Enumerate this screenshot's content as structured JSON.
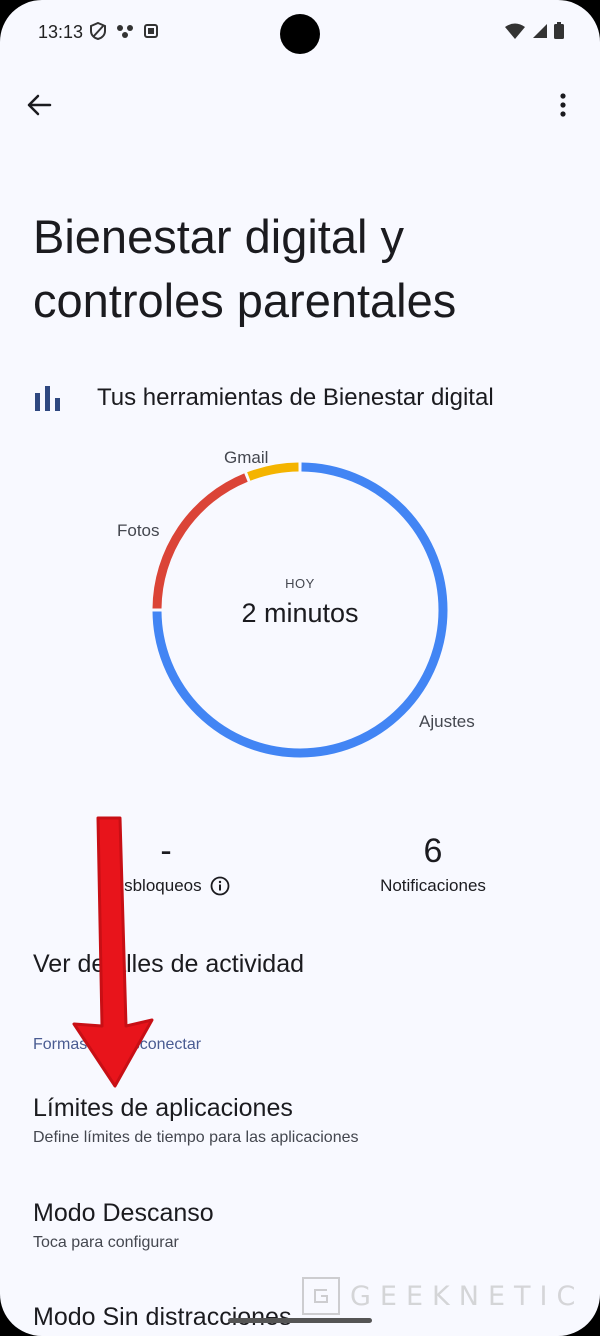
{
  "status": {
    "time": "13:13",
    "left_icons": [
      "shield-icon",
      "network-icon",
      "notification-app-icon"
    ],
    "right_icons": [
      "wifi-icon",
      "signal-icon",
      "battery-icon"
    ]
  },
  "header": {
    "back_icon": "arrow-left-icon",
    "more_icon": "more-vert-icon"
  },
  "page": {
    "title": "Bienestar digital y controles parentales"
  },
  "tools": {
    "label": "Tus herramientas de Bienestar digital",
    "icon": "bar-chart-icon"
  },
  "chart_data": {
    "type": "pie",
    "title": "",
    "center_label": "HOY",
    "center_value": "2 minutos",
    "series": [
      {
        "name": "Ajustes",
        "value": 75,
        "color": "#4285f4"
      },
      {
        "name": "Fotos",
        "value": 19,
        "color": "#db4437"
      },
      {
        "name": "Gmail",
        "value": 6,
        "color": "#f4b400"
      }
    ],
    "legend": "on-chart labels"
  },
  "stats": {
    "unlocks": {
      "value": "-",
      "label": "Desbloqueos",
      "icon": "info-icon"
    },
    "notifications": {
      "value": "6",
      "label": "Notificaciones"
    }
  },
  "activity_link": "Ver detalles de actividad",
  "section": {
    "label": "Formas de desconectar"
  },
  "items": [
    {
      "title": "Límites de aplicaciones",
      "subtitle": "Define límites de tiempo para las aplicaciones"
    },
    {
      "title": "Modo Descanso",
      "subtitle": "Toca para configurar"
    },
    {
      "title": "Modo Sin distracciones",
      "subtitle": ""
    }
  ],
  "watermark": {
    "text": "GEEKNETIC"
  },
  "colors": {
    "background": "#f8f9ff",
    "accent_label": "#4a5c92",
    "annotation_arrow": "#e8141b"
  }
}
